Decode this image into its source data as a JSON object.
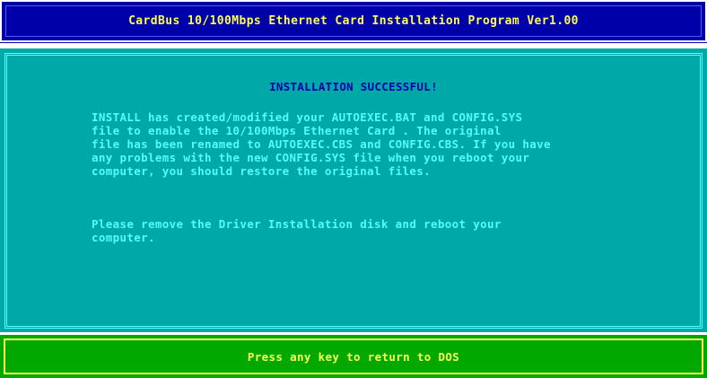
{
  "title_bar": {
    "title": "CardBus 10/100Mbps Ethernet Card Installation Program Ver1.00"
  },
  "main": {
    "heading": "INSTALLATION SUCCESSFUL!",
    "message_1": "INSTALL has created/modified your AUTOEXEC.BAT and CONFIG.SYS\nfile to enable the 10/100Mbps Ethernet Card . The original\nfile has been renamed to AUTOEXEC.CBS and CONFIG.CBS. If you have\nany problems with the new CONFIG.SYS file when you reboot your\ncomputer, you should restore the original files.",
    "message_2": "Please remove the Driver Installation disk and reboot your\ncomputer."
  },
  "status_bar": {
    "prompt": "Press any key to return to DOS"
  },
  "colors": {
    "title_bg": "#0000a8",
    "title_text": "#fcfc54",
    "panel_bg": "#00a8a8",
    "panel_text": "#54fcfc",
    "heading_text": "#0000a8",
    "status_bg": "#00a800",
    "status_text": "#fcfc54"
  }
}
